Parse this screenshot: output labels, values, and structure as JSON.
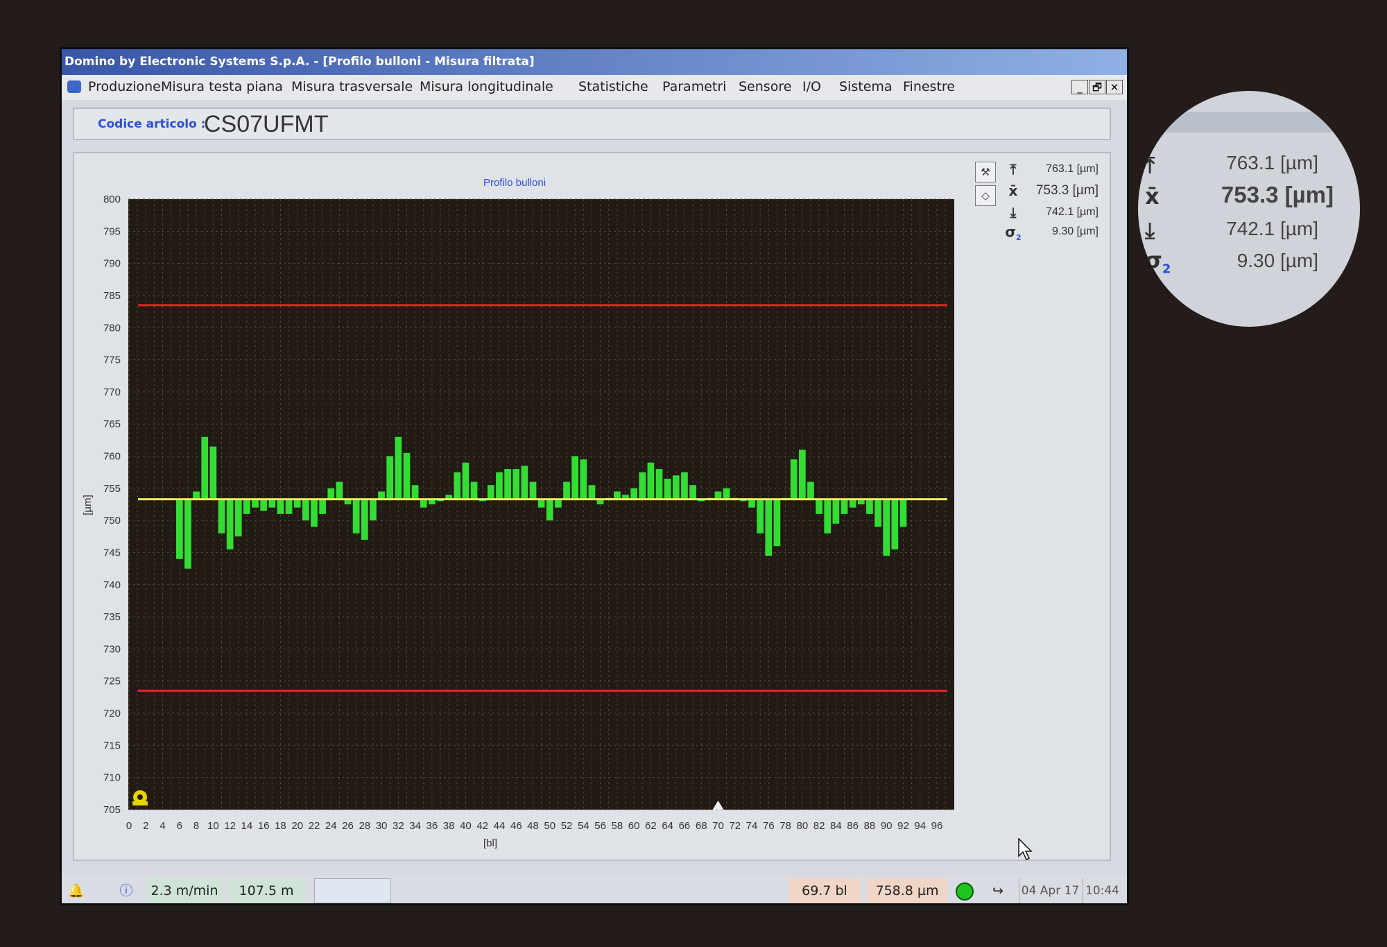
{
  "window": {
    "title": "Domino by Electronic Systems S.p.A. - [Profilo bulloni - Misura filtrata]"
  },
  "menu": {
    "items": [
      "Produzione",
      "Misura testa piana",
      "Misura trasversale",
      "Misura longitudinale",
      "Statistiche",
      "Parametri",
      "Sensore",
      "I/O",
      "Sistema",
      "Finestre"
    ]
  },
  "window_buttons": {
    "minimize": "_",
    "restore": "🗗",
    "close": "✕"
  },
  "article": {
    "label": "Codice articolo :",
    "code": "CS07UFMT"
  },
  "stats": {
    "max": "763.1 [µm]",
    "mean": "753.3 [µm]",
    "min": "742.1 [µm]",
    "sigma": "9.30 [µm]",
    "max_icon": "max-arrow-icon",
    "mean_icon": "x-bar-icon",
    "min_icon": "min-arrow-icon",
    "sigma_icon": "sigma-icon"
  },
  "zoom_inset": {
    "max": "763.1 [µm]",
    "mean": "753.3 [µm]",
    "min": "742.1 [µm]",
    "sigma": "9.30 [µm]"
  },
  "statusbar": {
    "speed": "2.3 m/min",
    "length": "107.5 m",
    "position_bl": "69.7 bl",
    "value_um": "758.8 µm",
    "date": "04 Apr 17",
    "time": "10:44"
  },
  "colors": {
    "plot_bg": "#221a15",
    "bar": "#33dd33",
    "limit": "#ee2222",
    "mean_line": "#f0f060",
    "title_blue": "#2c4fd8"
  },
  "chart_data": {
    "type": "bar",
    "title": "Profilo bulloni",
    "xlabel": "[bl]",
    "ylabel": "[µm]",
    "ylim": [
      705,
      800
    ],
    "xlim": [
      0,
      97
    ],
    "yticks": [
      800,
      795,
      790,
      785,
      780,
      775,
      770,
      765,
      760,
      755,
      750,
      745,
      740,
      735,
      730,
      725,
      720,
      715,
      710,
      705
    ],
    "xticks": [
      0,
      2,
      4,
      6,
      8,
      10,
      12,
      14,
      16,
      18,
      20,
      22,
      24,
      26,
      28,
      30,
      32,
      34,
      36,
      38,
      40,
      42,
      44,
      46,
      48,
      50,
      52,
      54,
      56,
      58,
      60,
      62,
      64,
      66,
      68,
      70,
      72,
      74,
      76,
      78,
      80,
      82,
      84,
      86,
      88,
      90,
      92,
      94,
      96
    ],
    "baseline": 753.3,
    "upper_limit": 783.5,
    "lower_limit": 723.5,
    "grid": true,
    "marker_position": 70,
    "x": [
      6,
      7,
      8,
      9,
      10,
      11,
      12,
      13,
      14,
      15,
      16,
      17,
      18,
      19,
      20,
      21,
      22,
      23,
      24,
      25,
      26,
      27,
      28,
      29,
      30,
      31,
      32,
      33,
      34,
      35,
      36,
      37,
      38,
      39,
      40,
      41,
      42,
      43,
      44,
      45,
      46,
      47,
      48,
      49,
      50,
      51,
      52,
      53,
      54,
      55,
      56,
      57,
      58,
      59,
      60,
      61,
      62,
      63,
      64,
      65,
      66,
      67,
      68,
      69,
      70,
      71,
      72,
      73,
      74,
      75,
      76,
      77,
      78,
      79,
      80,
      81,
      82,
      83,
      84,
      85,
      86,
      87,
      88,
      89,
      90,
      91,
      92
    ],
    "values": [
      744.0,
      742.5,
      754.5,
      763.0,
      761.5,
      748.0,
      745.5,
      747.5,
      751.0,
      752.0,
      751.5,
      752.0,
      751.0,
      751.0,
      752.0,
      750.0,
      749.0,
      751.0,
      755.0,
      756.0,
      752.5,
      748.0,
      747.0,
      750.0,
      754.5,
      760.0,
      763.0,
      760.5,
      755.5,
      752.0,
      752.5,
      753.0,
      754.0,
      757.5,
      759.0,
      756.0,
      753.0,
      755.5,
      757.5,
      758.0,
      758.0,
      758.5,
      756.0,
      752.0,
      750.0,
      752.0,
      756.0,
      760.0,
      759.5,
      755.5,
      752.5,
      753.5,
      754.5,
      754.0,
      755.0,
      757.5,
      759.0,
      758.0,
      756.5,
      757.0,
      757.5,
      755.5,
      753.0,
      753.5,
      754.5,
      755.0,
      753.5,
      753.0,
      752.0,
      748.0,
      744.5,
      746.0,
      753.5,
      759.5,
      761.0,
      756.0,
      751.0,
      748.0,
      749.5,
      751.0,
      752.0,
      752.5,
      751.0,
      749.0,
      744.5,
      745.5,
      749.0
    ]
  }
}
